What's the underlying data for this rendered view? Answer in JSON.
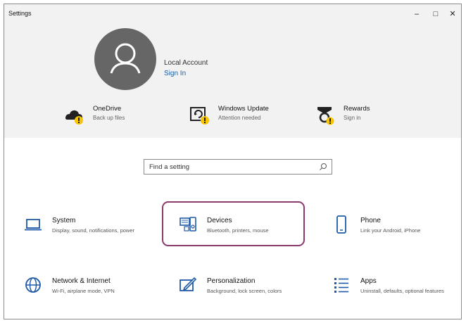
{
  "window": {
    "title": "Settings",
    "controls": {
      "minimize": "–",
      "maximize": "□",
      "close": "✕"
    }
  },
  "account": {
    "avatar_icon": "person-icon",
    "name": "Local Account",
    "sign_in": "Sign In"
  },
  "services": [
    {
      "title": "OneDrive",
      "subtitle": "Back up files",
      "icon": "onedrive-warning-icon"
    },
    {
      "title": "Windows Update",
      "subtitle": "Attention needed",
      "icon": "windows-update-warning-icon"
    },
    {
      "title": "Rewards",
      "subtitle": "Sign in",
      "icon": "rewards-warning-icon"
    }
  ],
  "search": {
    "placeholder": "Find a setting",
    "icon": "search-icon"
  },
  "categories": [
    {
      "title": "System",
      "subtitle": "Display, sound, notifications, power",
      "icon": "laptop-icon"
    },
    {
      "title": "Devices",
      "subtitle": "Bluetooth, printers, mouse",
      "icon": "devices-icon"
    },
    {
      "title": "Phone",
      "subtitle": "Link your Android, iPhone",
      "icon": "phone-icon"
    },
    {
      "title": "Network & Internet",
      "subtitle": "Wi-Fi, airplane mode, VPN",
      "icon": "globe-icon"
    },
    {
      "title": "Personalization",
      "subtitle": "Background, lock screen, colors",
      "icon": "personalization-icon"
    },
    {
      "title": "Apps",
      "subtitle": "Uninstall, defaults, optional features",
      "icon": "apps-list-icon"
    }
  ],
  "colors": {
    "accent": "#1a5fa8",
    "highlight_border": "#8a3a6b",
    "warning": "#f7c600",
    "icon_blue": "#1f5aa8"
  }
}
